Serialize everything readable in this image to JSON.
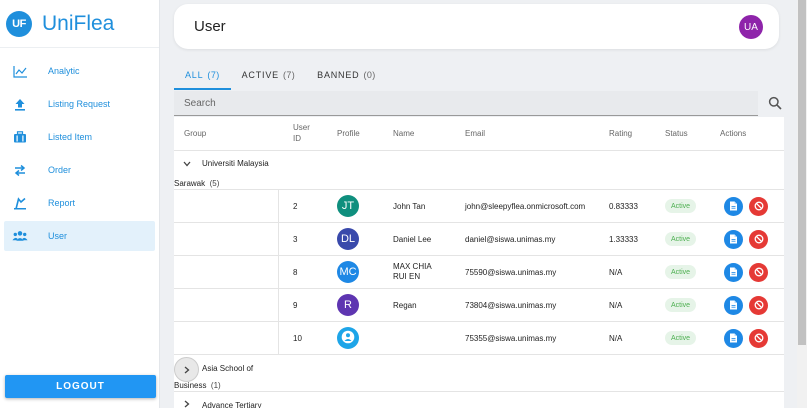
{
  "brand": {
    "logo": "UF",
    "name": "UniFlea"
  },
  "sidebar": {
    "items": [
      {
        "label": "Analytic",
        "icon": "chart-line-icon"
      },
      {
        "label": "Listing Request",
        "icon": "upload-icon"
      },
      {
        "label": "Listed Item",
        "icon": "briefcase-icon"
      },
      {
        "label": "Order",
        "icon": "swap-arrows-icon"
      },
      {
        "label": "Report",
        "icon": "report-icon"
      },
      {
        "label": "User",
        "icon": "users-icon",
        "active": true
      }
    ],
    "logout_label": "LOGOUT"
  },
  "header": {
    "title": "User",
    "avatar": "UA"
  },
  "tabs": [
    {
      "label": "ALL",
      "count": "(7)",
      "active": true
    },
    {
      "label": "ACTIVE",
      "count": "(7)"
    },
    {
      "label": "BANNED",
      "count": "(0)"
    }
  ],
  "search": {
    "placeholder": "Search"
  },
  "table": {
    "columns": [
      "Group",
      "User ID",
      "Profile",
      "Name",
      "Email",
      "Rating",
      "Status",
      "Actions"
    ],
    "groups": [
      {
        "name_line1": "Universiti Malaysia",
        "name_line2": "Sarawak",
        "count": "(5)",
        "expanded": true,
        "rows": [
          {
            "id": "2",
            "initials": "JT",
            "color": "#0f8f7e",
            "name": "John Tan",
            "email": "john@sleepyflea.onmicrosoft.com",
            "rating": "0.83333",
            "status": "Active"
          },
          {
            "id": "3",
            "initials": "DL",
            "color": "#3949ab",
            "name": "Daniel Lee",
            "email": "daniel@siswa.unimas.my",
            "rating": "1.33333",
            "status": "Active"
          },
          {
            "id": "8",
            "initials": "MC",
            "color": "#1e88e5",
            "name": "MAX CHIA RUI EN",
            "email": "75590@siswa.unimas.my",
            "rating": "N/A",
            "status": "Active"
          },
          {
            "id": "9",
            "initials": "R",
            "color": "#5e35b1",
            "name": "Regan",
            "email": "73804@siswa.unimas.my",
            "rating": "N/A",
            "status": "Active"
          },
          {
            "id": "10",
            "initials": "",
            "color": "#1ea5e8",
            "name": "",
            "email": "75355@siswa.unimas.my",
            "rating": "N/A",
            "status": "Active"
          }
        ]
      },
      {
        "name_line1": "Asia School of",
        "name_line2": "Business",
        "count": "(1)",
        "expanded": false
      },
      {
        "name_line1": "Advance Tertiary",
        "name_line2": "",
        "count": "",
        "expanded": false
      }
    ]
  }
}
